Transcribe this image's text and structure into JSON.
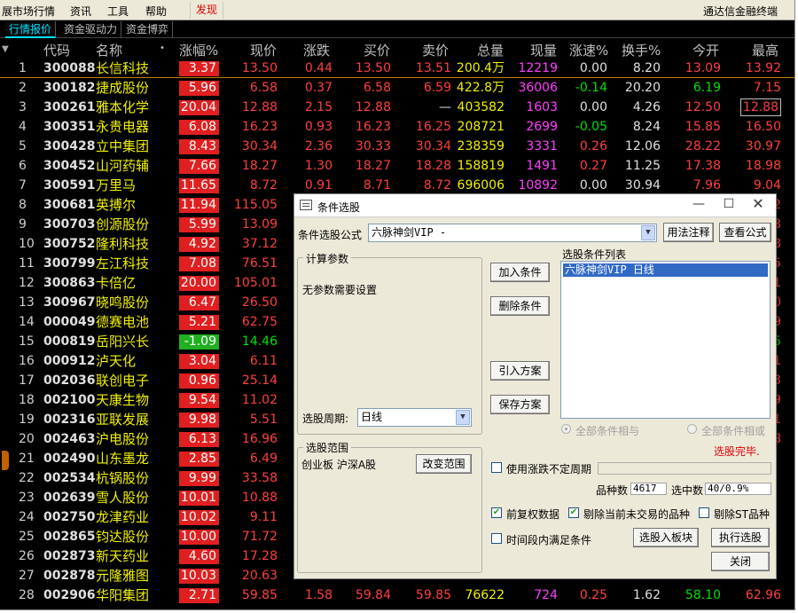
{
  "menubar": {
    "items": [
      "展市场行情",
      "资讯",
      "工具",
      "帮助"
    ],
    "highlight": "发现",
    "right": "通达信金融终端"
  },
  "subtabs": [
    "行情报价",
    "资金驱动力",
    "资金博弈"
  ],
  "columns": {
    "rank": "",
    "code": "代码",
    "name": "名称",
    "dot": "•",
    "pct": "涨幅%",
    "price": "现价",
    "chg": "涨跌",
    "bid": "买价",
    "ask": "卖价",
    "vol": "总量",
    "cur": "现量",
    "speed": "涨速%",
    "turn": "换手%",
    "open": "今开",
    "high": "最高"
  },
  "rows": [
    {
      "n": "1",
      "code": "300088",
      "name": "长信科技",
      "pct": "3.37",
      "price": "13.50",
      "chg": "0.44",
      "bid": "13.50",
      "ask": "13.51",
      "vol": "200.4万",
      "cur": "12219",
      "speed": "0.00",
      "turn": "8.20",
      "open": "13.09",
      "high": "13.92"
    },
    {
      "n": "2",
      "code": "300182",
      "name": "捷成股份",
      "pct": "5.96",
      "price": "6.58",
      "chg": "0.37",
      "bid": "6.58",
      "ask": "6.59",
      "vol": "422.8万",
      "cur": "36006",
      "speed": "-0.14",
      "turn": "20.20",
      "open": "6.19",
      "high": "7.15"
    },
    {
      "n": "3",
      "code": "300261",
      "name": "雅本化学",
      "pct": "20.04",
      "price": "12.88",
      "chg": "2.15",
      "bid": "12.88",
      "ask": "—",
      "vol": "403582",
      "cur": "1603",
      "speed": "0.00",
      "turn": "4.26",
      "open": "12.50",
      "high": "12.88"
    },
    {
      "n": "4",
      "code": "300351",
      "name": "永贵电器",
      "pct": "6.08",
      "price": "16.23",
      "chg": "0.93",
      "bid": "16.23",
      "ask": "16.25",
      "vol": "208721",
      "cur": "2699",
      "speed": "-0.05",
      "turn": "8.24",
      "open": "15.85",
      "high": "16.50"
    },
    {
      "n": "5",
      "code": "300428",
      "name": "立中集团",
      "pct": "8.43",
      "price": "30.34",
      "chg": "2.36",
      "bid": "30.33",
      "ask": "30.34",
      "vol": "238359",
      "cur": "3331",
      "speed": "0.26",
      "turn": "12.06",
      "open": "28.22",
      "high": "30.97"
    },
    {
      "n": "6",
      "code": "300452",
      "name": "山河药辅",
      "pct": "7.66",
      "price": "18.27",
      "chg": "1.30",
      "bid": "18.27",
      "ask": "18.28",
      "vol": "158819",
      "cur": "1491",
      "speed": "0.27",
      "turn": "11.25",
      "open": "17.38",
      "high": "18.98"
    },
    {
      "n": "7",
      "code": "300591",
      "name": "万里马",
      "pct": "11.65",
      "price": "8.72",
      "chg": "0.91",
      "bid": "8.71",
      "ask": "8.72",
      "vol": "696006",
      "cur": "10892",
      "speed": "0.00",
      "turn": "30.94",
      "open": "7.96",
      "high": "9.04"
    },
    {
      "n": "8",
      "code": "300681",
      "name": "英搏尔",
      "pct": "11.94",
      "price": "115.05",
      "high": "2"
    },
    {
      "n": "9",
      "code": "300703",
      "name": "创源股份",
      "pct": "5.99",
      "price": "13.09",
      "high": "8"
    },
    {
      "n": "10",
      "code": "300752",
      "name": "隆利科技",
      "pct": "4.92",
      "price": "37.12",
      "high": "8"
    },
    {
      "n": "11",
      "code": "300799",
      "name": "左江科技",
      "pct": "7.08",
      "price": "76.51",
      "high": "5"
    },
    {
      "n": "12",
      "code": "300863",
      "name": "卡倍亿",
      "pct": "20.00",
      "price": "105.01",
      "high": "1"
    },
    {
      "n": "13",
      "code": "300967",
      "name": "晓鸣股份",
      "pct": "6.47",
      "price": "26.50",
      "high": "0"
    },
    {
      "n": "14",
      "code": "000049",
      "name": "德赛电池",
      "pct": "5.21",
      "price": "62.75",
      "high": "9"
    },
    {
      "n": "15",
      "code": "000819",
      "name": "岳阳兴长",
      "pct": "-1.09",
      "price": "14.46",
      "high": "5"
    },
    {
      "n": "16",
      "code": "000912",
      "name": "泸天化",
      "pct": "3.04",
      "price": "6.11",
      "high": "1"
    },
    {
      "n": "17",
      "code": "002036",
      "name": "联创电子",
      "pct": "0.96",
      "price": "25.14",
      "high": "3"
    },
    {
      "n": "18",
      "code": "002100",
      "name": "天康生物",
      "pct": "9.54",
      "price": "11.02",
      "high": "9"
    },
    {
      "n": "19",
      "code": "002316",
      "name": "亚联发展",
      "pct": "9.98",
      "price": "5.51",
      "high": "1"
    },
    {
      "n": "20",
      "code": "002463",
      "name": "沪电股份",
      "pct": "6.13",
      "price": "16.96",
      "high": "8"
    },
    {
      "n": "21",
      "code": "002490",
      "name": "山东墨龙",
      "pct": "2.85",
      "price": "6.49",
      "high": ""
    },
    {
      "n": "22",
      "code": "002534",
      "name": "杭锅股份",
      "pct": "9.99",
      "price": "33.58",
      "high": ""
    },
    {
      "n": "23",
      "code": "002639",
      "name": "雪人股份",
      "pct": "10.01",
      "price": "10.88",
      "high": ""
    },
    {
      "n": "24",
      "code": "002750",
      "name": "龙津药业",
      "pct": "10.02",
      "price": "9.11",
      "high": ""
    },
    {
      "n": "25",
      "code": "002865",
      "name": "钧达股份",
      "pct": "10.00",
      "price": "71.72",
      "high": ""
    },
    {
      "n": "26",
      "code": "002873",
      "name": "新天药业",
      "pct": "4.60",
      "price": "17.28",
      "high": ""
    },
    {
      "n": "27",
      "code": "002878",
      "name": "元隆雅图",
      "pct": "10.03",
      "price": "20.63",
      "high": ""
    },
    {
      "n": "28",
      "code": "002906",
      "name": "华阳集团",
      "pct": "2.71",
      "price": "59.85",
      "chg": "1.58",
      "bid": "59.84",
      "ask": "59.85",
      "vol": "76622",
      "cur": "724",
      "speed": "0.25",
      "turn": "1.62",
      "open": "58.10",
      "high": "62.96"
    }
  ],
  "dialog": {
    "title": "条件选股",
    "formula_label": "条件选股公式",
    "formula_value": "六脉神剑VIP  -",
    "usage_btn": "用法注释",
    "view_btn": "查看公式",
    "params_group": "计算参数",
    "params_text": "无参数需要设置",
    "period_label": "选股周期:",
    "period_value": "日线",
    "add_btn": "加入条件",
    "del_btn": "删除条件",
    "import_btn": "引入方案",
    "save_btn": "保存方案",
    "list_label": "选股条件列表",
    "list_item": "六脉神剑VIP  日线",
    "radio_and": "全部条件相与",
    "radio_or": "全部条件相或",
    "status": "选股完毕.",
    "range_group": "选股范围",
    "range_text": "创业板 沪深A股",
    "range_btn": "改变范围",
    "use_period_label": "使用涨跌不定周期",
    "count_label": "品种数",
    "count_value": "4617",
    "selected_label": "选中数",
    "selected_value": "40/0.9%",
    "cb_prefq": "前复权数据",
    "cb_exclude": "剔除当前未交易的品种",
    "cb_st": "剔除ST品种",
    "cb_timeseg": "时间段内满足条件",
    "to_block_btn": "选股入板块",
    "run_btn": "执行选股",
    "close_btn": "关闭"
  }
}
